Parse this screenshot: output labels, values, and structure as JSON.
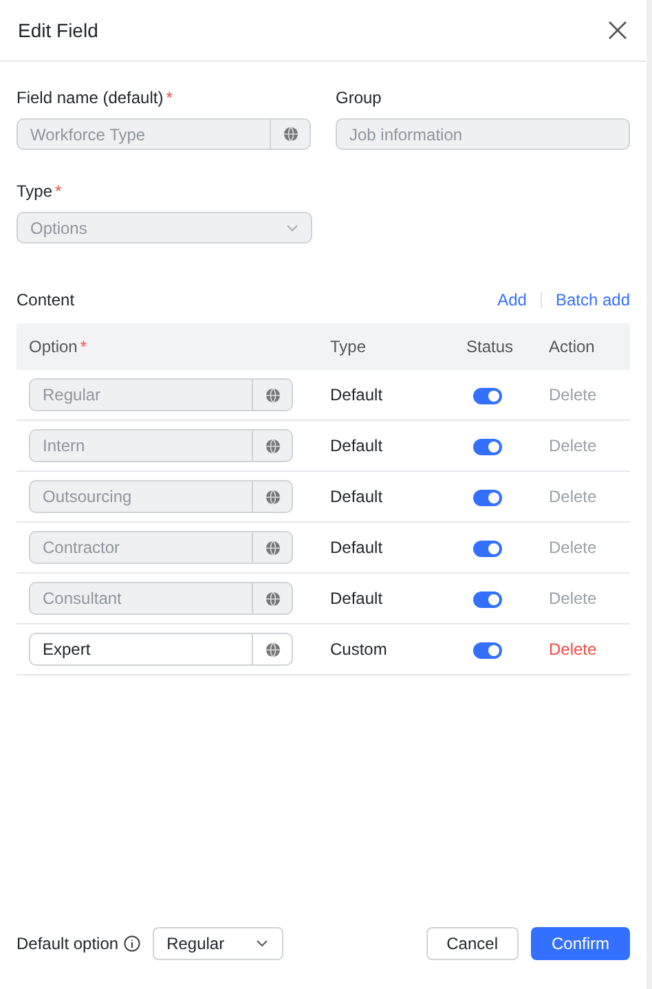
{
  "dialog": {
    "title": "Edit Field"
  },
  "field_name": {
    "label": "Field name (default)",
    "required_mark": "*",
    "value": "Workforce Type",
    "disabled": true
  },
  "group": {
    "label": "Group",
    "value": "Job information",
    "disabled": true
  },
  "type": {
    "label": "Type",
    "required_mark": "*",
    "value": "Options",
    "disabled": true
  },
  "content": {
    "label": "Content",
    "actions": [
      "Add",
      "Batch add"
    ]
  },
  "table": {
    "columns": [
      {
        "label": "Option",
        "required_mark": "*"
      },
      {
        "label": "Type"
      },
      {
        "label": "Status"
      },
      {
        "label": "Action"
      }
    ],
    "rows": [
      {
        "option": "Regular",
        "disabled": true,
        "type": "Default",
        "on": true,
        "action": "Delete",
        "action_disabled": true
      },
      {
        "option": "Intern",
        "disabled": true,
        "type": "Default",
        "on": true,
        "action": "Delete",
        "action_disabled": true
      },
      {
        "option": "Outsourcing",
        "disabled": true,
        "type": "Default",
        "on": true,
        "action": "Delete",
        "action_disabled": true
      },
      {
        "option": "Contractor",
        "disabled": true,
        "type": "Default",
        "on": true,
        "action": "Delete",
        "action_disabled": true
      },
      {
        "option": "Consultant",
        "disabled": true,
        "type": "Default",
        "on": true,
        "action": "Delete",
        "action_disabled": true
      },
      {
        "option": "Expert",
        "disabled": false,
        "type": "Custom",
        "on": true,
        "action": "Delete",
        "action_disabled": false
      }
    ]
  },
  "default_option": {
    "label": "Default option",
    "value": "Regular"
  },
  "buttons": [
    {
      "label": "Cancel",
      "kind": "secondary"
    },
    {
      "label": "Confirm",
      "kind": "primary"
    }
  ]
}
